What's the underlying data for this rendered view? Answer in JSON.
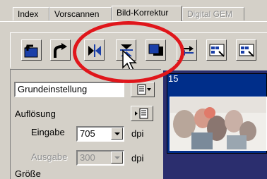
{
  "tabs": [
    {
      "label": "Index",
      "state": "normal"
    },
    {
      "label": "Vorscannen",
      "state": "normal"
    },
    {
      "label": "Bild-Korrektur",
      "state": "active"
    },
    {
      "label": "Digital GEM",
      "state": "disabled"
    }
  ],
  "toolbar": {
    "buttons": [
      {
        "name": "rotate-left-icon"
      },
      {
        "name": "rotate-right-icon"
      },
      {
        "name": "mirror-horizontal-icon"
      },
      {
        "name": "mirror-vertical-icon"
      },
      {
        "name": "negative-positive-icon"
      },
      {
        "name": "swap-icon"
      },
      {
        "name": "frame-grid-icon"
      },
      {
        "name": "frame-grid-2-icon"
      }
    ]
  },
  "settings": {
    "preset_value": "Grundeinstellung",
    "resolution_label": "Auflösung",
    "input_label": "Eingabe",
    "input_value": "705",
    "input_unit": "dpi",
    "output_label": "Ausgabe",
    "output_value": "300",
    "output_unit": "dpi",
    "size_label": "Größe"
  },
  "preview": {
    "frame_number": "15"
  },
  "colors": {
    "accent_circle": "#e0161b",
    "preview_bg": "#002e8a"
  }
}
